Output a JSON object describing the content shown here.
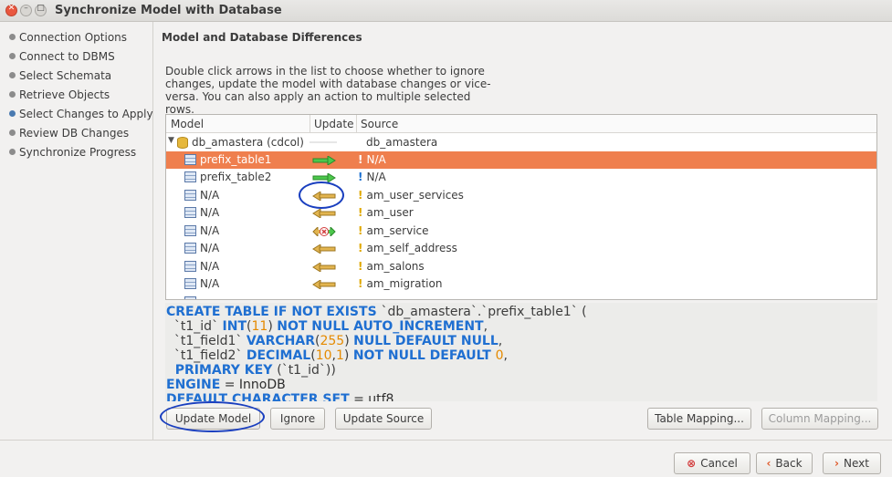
{
  "window": {
    "title": "Synchronize Model with Database"
  },
  "steps": [
    {
      "label": "Connection Options"
    },
    {
      "label": "Connect to DBMS"
    },
    {
      "label": "Select Schemata"
    },
    {
      "label": "Retrieve Objects"
    },
    {
      "label": "Select Changes to Apply",
      "current": true
    },
    {
      "label": "Review DB Changes"
    },
    {
      "label": "Synchronize Progress"
    }
  ],
  "main": {
    "heading": "Model and Database Differences",
    "description": "Double click arrows in the list to choose whether to ignore changes, update the model with database changes or vice-versa. You can also apply an action to multiple selected rows."
  },
  "grid": {
    "columns": {
      "model": "Model",
      "update": "Update",
      "source": "Source"
    },
    "schema": {
      "model": "db_amastera (cdcol)",
      "source": "db_amastera"
    },
    "rows": [
      {
        "model": "prefix_table1",
        "action": "arrow-right-icon",
        "marker": "!",
        "source": "N/A",
        "selected": true
      },
      {
        "model": "prefix_table2",
        "action": "arrow-right-icon",
        "marker": "!",
        "source": "N/A"
      },
      {
        "model": "N/A",
        "action": "arrow-left-icon",
        "marker": "!",
        "source": "am_user_services"
      },
      {
        "model": "N/A",
        "action": "arrow-left-icon",
        "marker": "!",
        "source": "am_user"
      },
      {
        "model": "N/A",
        "action": "ignore-icon",
        "marker": "!",
        "source": "am_service"
      },
      {
        "model": "N/A",
        "action": "arrow-left-icon",
        "marker": "!",
        "source": "am_self_address"
      },
      {
        "model": "N/A",
        "action": "arrow-left-icon",
        "marker": "!",
        "source": "am_salons"
      },
      {
        "model": "N/A",
        "action": "arrow-left-icon",
        "marker": "!",
        "source": "am_migration"
      }
    ]
  },
  "sql": {
    "line1": {
      "kw": "CREATE TABLE IF NOT EXISTS ",
      "id": "`db_amastera`",
      "dot": ".",
      "id2": "`prefix_table1`",
      "end": " ("
    },
    "line2": {
      "id": "  `t1_id` ",
      "kw": "INT",
      "p1": "(",
      "num": "11",
      "p2": ") ",
      "kw2": "NOT NULL AUTO_INCREMENT",
      "end": ","
    },
    "line3": {
      "id": "  `t1_field1` ",
      "kw": "VARCHAR",
      "p1": "(",
      "num": "255",
      "p2": ") ",
      "kw2": "NULL DEFAULT NULL",
      "end": ","
    },
    "line4": {
      "id": "  `t1_field2` ",
      "kw": "DECIMAL",
      "p1": "(",
      "num": "10",
      "c": ",",
      "num2": "1",
      "p2": ") ",
      "kw2": "NOT NULL DEFAULT ",
      "num3": "0",
      "end": ","
    },
    "line5": {
      "kw": "  PRIMARY KEY ",
      "p1": "(",
      "id": "`t1_id`",
      "p2": "))"
    },
    "line6": {
      "kw": "ENGINE",
      "plain": " = InnoDB"
    },
    "line7": {
      "kw": "DEFAULT CHARACTER SET",
      "plain": " = utf8"
    }
  },
  "actions": {
    "update_model": "Update Model",
    "ignore": "Ignore",
    "update_source": "Update Source",
    "table_mapping": "Table Mapping...",
    "column_mapping": "Column Mapping..."
  },
  "footer": {
    "cancel": "Cancel",
    "back": "Back",
    "next": "Next"
  },
  "colors": {
    "selection": "#ef7f4e",
    "annotation": "#1a3fbf",
    "keyword": "#1f6fd1",
    "number": "#e58a00"
  }
}
